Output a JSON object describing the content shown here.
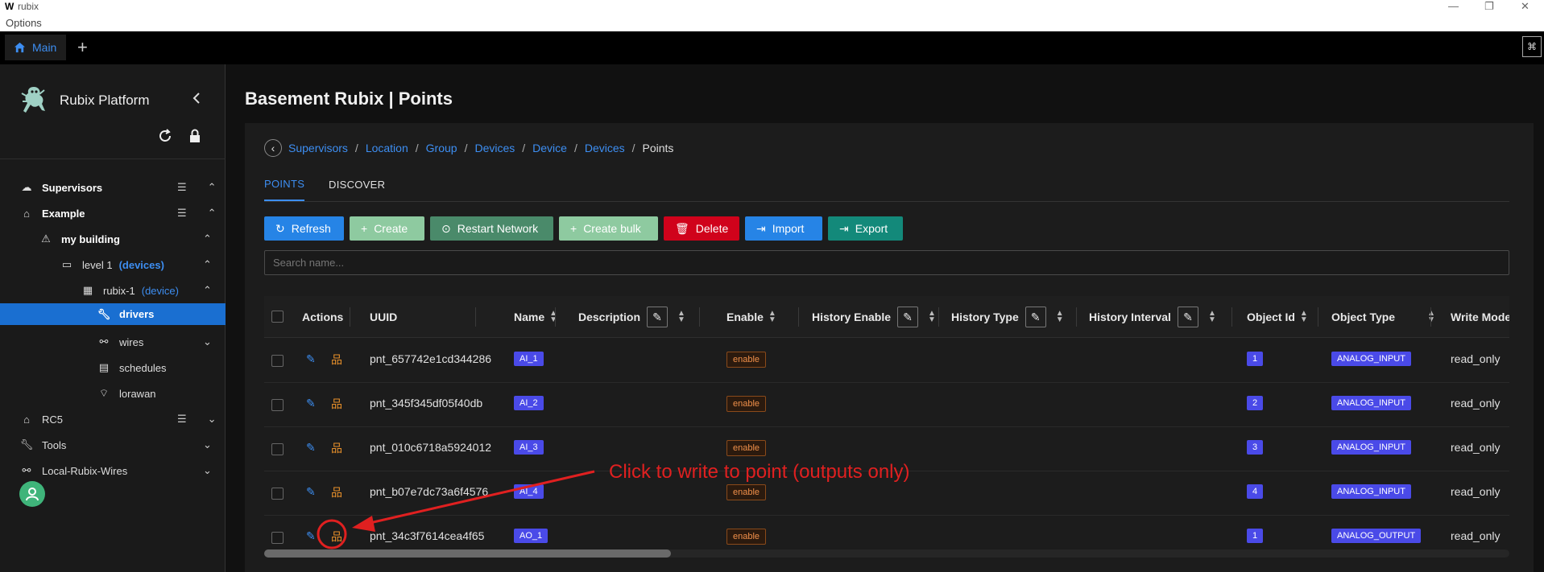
{
  "window": {
    "title": "rubix",
    "menu": "Options"
  },
  "tabbar": {
    "main_tab": "Main",
    "add_tab": "+"
  },
  "sidebar": {
    "brand": "Rubix Platform",
    "items": [
      {
        "label": "Supervisors"
      },
      {
        "label": "Example"
      },
      {
        "label": "my building"
      },
      {
        "label": "level 1",
        "suffix": "(devices)"
      },
      {
        "label": "rubix-1",
        "suffix": "(device)"
      },
      {
        "label": "drivers"
      },
      {
        "label": "wires"
      },
      {
        "label": "schedules"
      },
      {
        "label": "lorawan"
      },
      {
        "label": "RC5"
      },
      {
        "label": "Tools"
      },
      {
        "label": "Local-Rubix-Wires"
      }
    ]
  },
  "page": {
    "title": "Basement Rubix | Points"
  },
  "breadcrumb": {
    "items": [
      "Supervisors",
      "Location",
      "Group",
      "Devices",
      "Device",
      "Devices"
    ],
    "current": "Points"
  },
  "tabs": [
    "POINTS",
    "DISCOVER"
  ],
  "toolbar": {
    "buttons": [
      "Refresh",
      "Create",
      "Restart Network",
      "Create bulk",
      "Delete",
      "Import",
      "Export"
    ],
    "colors": {
      "refresh": "#2684e6",
      "create": "#8ecaa0",
      "restart": "#4a8a6a",
      "bulk": "#8ecaa0",
      "delete": "#d0021b",
      "import": "#2684e6",
      "export": "#13897a"
    }
  },
  "search": {
    "placeholder": "Search name..."
  },
  "table": {
    "headers": [
      "Actions",
      "UUID",
      "Name",
      "Description",
      "Enable",
      "History Enable",
      "History Type",
      "History Interval",
      "Object Id",
      "Object Type",
      "Write Mode"
    ],
    "rows": [
      {
        "uuid": "pnt_657742e1cd344286",
        "name": "AI_1",
        "enable": "enable",
        "object_id": "1",
        "object_type": "ANALOG_INPUT",
        "write_mode": "read_only"
      },
      {
        "uuid": "pnt_345f345df05f40db",
        "name": "AI_2",
        "enable": "enable",
        "object_id": "2",
        "object_type": "ANALOG_INPUT",
        "write_mode": "read_only"
      },
      {
        "uuid": "pnt_010c6718a5924012",
        "name": "AI_3",
        "enable": "enable",
        "object_id": "3",
        "object_type": "ANALOG_INPUT",
        "write_mode": "read_only"
      },
      {
        "uuid": "pnt_b07e7dc73a6f4576",
        "name": "AI_4",
        "enable": "enable",
        "object_id": "4",
        "object_type": "ANALOG_INPUT",
        "write_mode": "read_only"
      },
      {
        "uuid": "pnt_34c3f7614cea4f65",
        "name": "AO_1",
        "enable": "enable",
        "object_id": "1",
        "object_type": "ANALOG_OUTPUT",
        "write_mode": "read_only"
      }
    ]
  },
  "annotation": {
    "text": "Click to write to point (outputs only)",
    "color": "#e02020"
  }
}
